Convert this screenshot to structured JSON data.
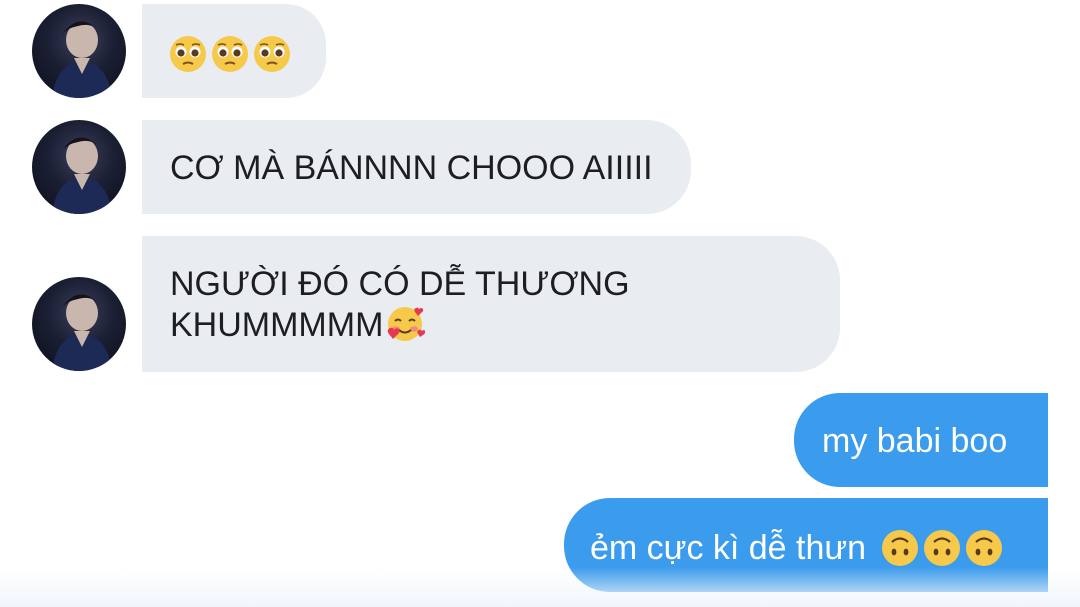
{
  "messages": [
    {
      "sender": "them",
      "text": "",
      "emojis": [
        "pleading-face-emoji",
        "pleading-face-emoji",
        "pleading-face-emoji"
      ]
    },
    {
      "sender": "them",
      "text": "CƠ MÀ BÁNNNN CHOOO AIIIII"
    },
    {
      "sender": "them",
      "lines": [
        "NGƯỜI ĐÓ CÓ DỄ THƯƠNG",
        "KHUMMMMM"
      ],
      "emojis": [
        "smiling-face-with-hearts-emoji"
      ]
    },
    {
      "sender": "me",
      "text": "my babi boo"
    },
    {
      "sender": "me",
      "text": "ẻm cực kì dễ thưn",
      "emojis": [
        "upside-down-face-emoji",
        "upside-down-face-emoji",
        "upside-down-face-emoji"
      ]
    }
  ],
  "colors": {
    "incoming_bubble": "#e9ecf1",
    "outgoing_bubble": "#3b9bec",
    "incoming_text": "#1c1e21",
    "outgoing_text": "#ffffff"
  }
}
